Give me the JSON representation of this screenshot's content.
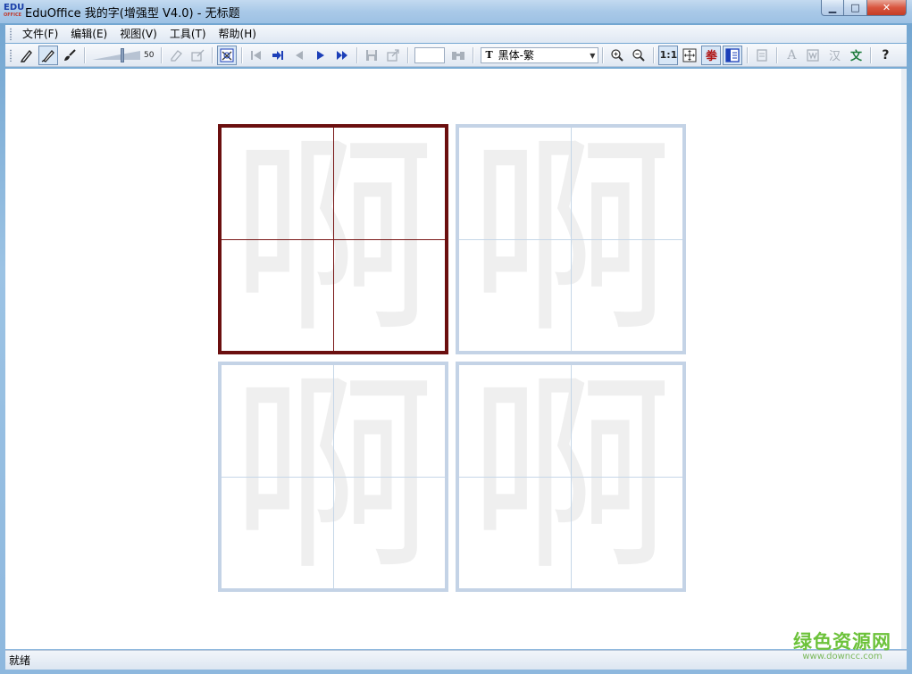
{
  "window": {
    "title": "EduOffice 我的字(增强型 V4.0) - 无标题",
    "logo_text": "EDU",
    "logo_sub": "OFFICE",
    "minimize_glyph": "▁",
    "maximize_glyph": "□",
    "close_glyph": "✕"
  },
  "menu": {
    "items": [
      {
        "label": "文件(F)"
      },
      {
        "label": "编辑(E)"
      },
      {
        "label": "视图(V)"
      },
      {
        "label": "工具(T)"
      },
      {
        "label": "帮助(H)"
      }
    ]
  },
  "toolbar": {
    "brush_size_value": "50",
    "font_name": "黑体-繁",
    "font_icon": "T",
    "zoom_1to1_label": "1:1",
    "char_icon_label": "拳",
    "text_a_label": "A",
    "han_label": "汉",
    "wen_label": "文",
    "help_label": "?"
  },
  "grid": {
    "character": "啊",
    "active_cell": 0,
    "cells": [
      "啊",
      "啊",
      "啊",
      "啊"
    ]
  },
  "status": {
    "text": "就绪"
  },
  "watermark": {
    "brand": "绿色资源网",
    "url": "www.downcc.com"
  },
  "colors": {
    "active_border": "#6b0f0f",
    "cell_border": "#c4d3e6",
    "guide": "#c6d7e8",
    "glyph": "#efefef"
  }
}
